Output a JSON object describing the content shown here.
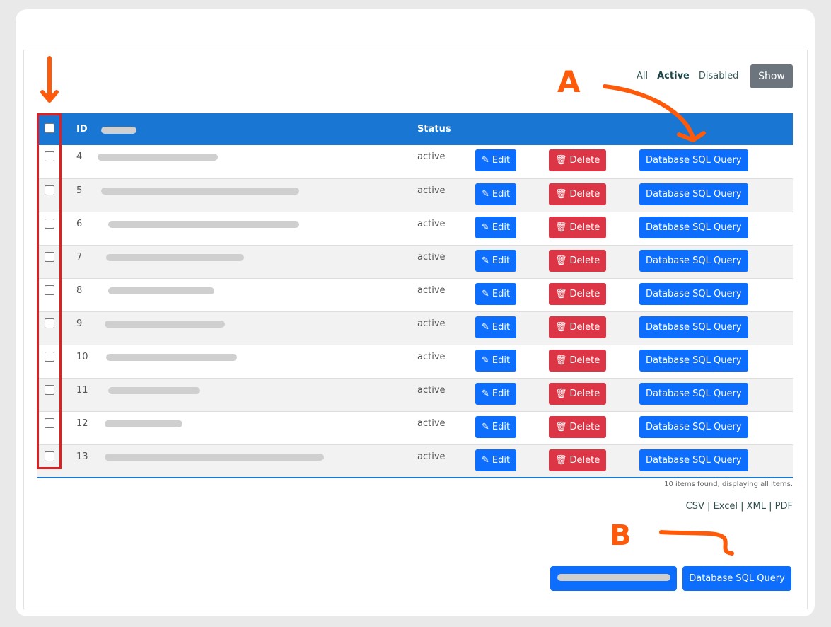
{
  "filters": {
    "all": "All",
    "active": "Active",
    "disabled": "Disabled"
  },
  "show_label": "Show",
  "table": {
    "headers": {
      "id": "ID",
      "status": "Status"
    },
    "rows": [
      {
        "id": "4",
        "status": "active"
      },
      {
        "id": "5",
        "status": "active"
      },
      {
        "id": "6",
        "status": "active"
      },
      {
        "id": "7",
        "status": "active"
      },
      {
        "id": "8",
        "status": "active"
      },
      {
        "id": "9",
        "status": "active"
      },
      {
        "id": "10",
        "status": "active"
      },
      {
        "id": "11",
        "status": "active"
      },
      {
        "id": "12",
        "status": "active"
      },
      {
        "id": "13",
        "status": "active"
      }
    ],
    "edit_label": "Edit",
    "delete_label": "Delete",
    "sql_label": "Database SQL Query"
  },
  "summary": "10 items found, displaying all items.",
  "exports": [
    "CSV",
    "Excel",
    "XML",
    "PDF"
  ],
  "bottom": {
    "sql_label": "Database SQL Query"
  },
  "annotations": {
    "a": "A",
    "b": "B"
  },
  "colors": {
    "header": "#1976d2",
    "primary": "#0d6efd",
    "danger": "#dc3545",
    "annotation": "#ff5a0a"
  }
}
